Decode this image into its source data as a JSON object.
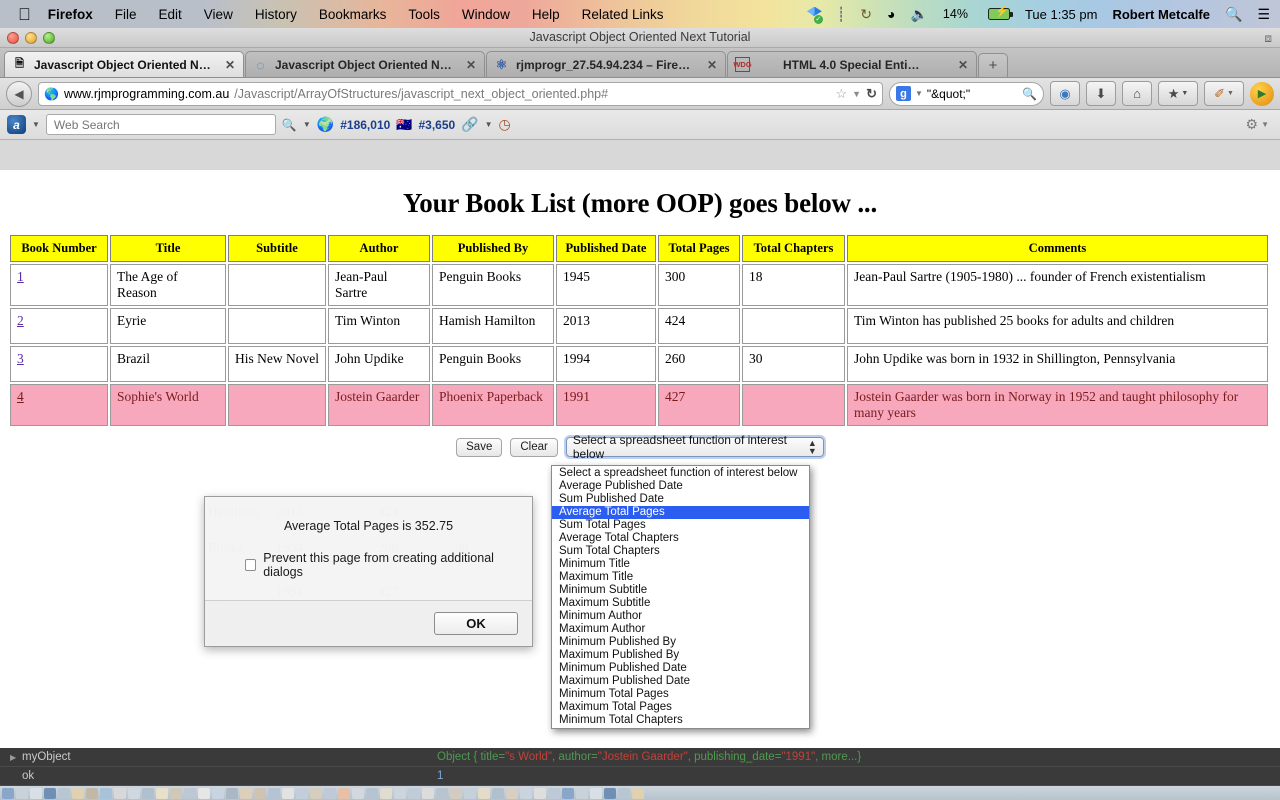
{
  "menubar": {
    "apple_icon": "apple-icon",
    "items": [
      "Firefox",
      "File",
      "Edit",
      "View",
      "History",
      "Bookmarks",
      "Tools",
      "Window",
      "Help",
      "Related Links"
    ],
    "status": {
      "dropbox_icon": "dropbox-icon",
      "bluetooth_icon": "bluetooth-icon",
      "timemachine_icon": "time-machine-icon",
      "wifi_icon": "wifi-icon",
      "volume_icon": "volume-icon",
      "battery_percent": "14%",
      "battery_icon": "battery-charging-icon",
      "clock": "Tue 1:35 pm",
      "user": "Robert Metcalfe",
      "spotlight_icon": "search-icon",
      "notifications_icon": "notification-center-icon"
    }
  },
  "window": {
    "title": "Javascript Object Oriented Next Tutorial",
    "fullscreen_icon": "fullscreen-icon"
  },
  "tabs": [
    {
      "label": "Javascript Object Oriented Next…",
      "favicon": "page-icon",
      "active": true
    },
    {
      "label": "Javascript Object Oriented Next…",
      "favicon": "loading-icon",
      "active": false
    },
    {
      "label": "rjmprogr_27.54.94.234 – FireFTP",
      "favicon": "fireftp-icon",
      "active": false
    },
    {
      "label": "HTML 4.0 Special Entities",
      "favicon": "wdg-icon",
      "active": false
    }
  ],
  "newtab_label": "+",
  "navbar": {
    "back_icon": "back-arrow-icon",
    "site_icon": "globe-icon",
    "url_domain": "www.rjmprogramming.com.au",
    "url_path": "/Javascript/ArrayOfStructures/javascript_next_object_oriented.php#",
    "bookmark_star_icon": "star-icon",
    "dropdown_icon": "chevron-down-icon",
    "reload_icon": "reload-icon",
    "search_engine_icon": "google-icon",
    "search_value": "\"&quot;\"",
    "search_go_icon": "search-icon",
    "buttons": [
      {
        "name": "feedly-icon",
        "glyph": "◔"
      },
      {
        "name": "download-icon",
        "glyph": "⬇"
      },
      {
        "name": "home-icon",
        "glyph": "⌂"
      },
      {
        "name": "bookmarks-icon",
        "glyph": "★"
      },
      {
        "name": "addon-icon",
        "glyph": "✎"
      },
      {
        "name": "play-icon",
        "glyph": "▶"
      }
    ]
  },
  "alexabar": {
    "alexa_icon": "alexa-icon",
    "search_placeholder": "Web Search",
    "search_value": "",
    "search_go_icon": "search-icon",
    "global_rank_icon": "globe-icon",
    "global_rank": "#186,010",
    "country_rank_icon": "au-flag-icon",
    "country_rank": "#3,650",
    "link_icon": "link-icon",
    "traffic_icon": "traffic-icon",
    "gear_icon": "gear-icon"
  },
  "page": {
    "title": "Your Book List (more OOP) goes below ...",
    "table": {
      "headers": [
        "Book Number",
        "Title",
        "Subtitle",
        "Author",
        "Published By",
        "Published Date",
        "Total Pages",
        "Total Chapters",
        "Comments"
      ],
      "rows": [
        {
          "highlighted": false,
          "cells": [
            "1",
            "The Age of Reason",
            "",
            "Jean-Paul Sartre",
            "Penguin Books",
            "1945",
            "300",
            "18",
            "Jean-Paul Sartre (1905-1980) ... founder of French existentialism"
          ]
        },
        {
          "highlighted": false,
          "cells": [
            "2",
            "Eyrie",
            "",
            "Tim Winton",
            "Hamish Hamilton",
            "2013",
            "424",
            "",
            "Tim Winton has published 25 books for adults and children"
          ]
        },
        {
          "highlighted": false,
          "cells": [
            "3",
            "Brazil",
            "His New Novel",
            "John Updike",
            "Penguin Books",
            "1994",
            "260",
            "30",
            "John Updike was born in 1932 in Shillington, Pennsylvania"
          ]
        },
        {
          "highlighted": true,
          "cells": [
            "4",
            "Sophie's World",
            "",
            "Jostein Gaarder",
            "Phoenix Paperback",
            "1991",
            "427",
            "",
            "Jostein Gaarder was born in Norway in 1952 and taught philosophy for many years"
          ]
        }
      ]
    },
    "controls": {
      "save_label": "Save",
      "clear_label": "Clear",
      "select_value": "Select a spreadsheet function of interest below",
      "select_arrows_icon": "updown-arrows-icon"
    },
    "dropdown": {
      "selected_index": 3,
      "options": [
        "Select a spreadsheet function of interest below",
        "Average Published Date",
        "Sum Published Date",
        "Average Total Pages",
        "Sum Total Pages",
        "Average Total Chapters",
        "Sum Total Chapters",
        "Minimum Title",
        "Maximum Title",
        "Minimum Subtitle",
        "Maximum Subtitle",
        "Minimum Author",
        "Maximum Author",
        "Minimum Published By",
        "Maximum Published By",
        "Minimum Published Date",
        "Maximum Published Date",
        "Minimum Total Pages",
        "Maximum Total Pages",
        "Minimum Total Chapters"
      ]
    }
  },
  "dialog": {
    "message": "Average Total Pages is 352.75",
    "checkbox_label": "Prevent this page from creating additional dialogs",
    "checkbox_checked": false,
    "ok_label": "OK"
  },
  "console": {
    "rows": [
      {
        "twisty": "▶",
        "name": "myObject",
        "type": "object",
        "obj_prefix": "Object { title=",
        "v1": "\"s World\"",
        "m1": ", author=",
        "v2": "\"Jostein Gaarder\"",
        "m2": ", publishing_date=",
        "v3": "\"1991\"",
        "suffix": ", more...}"
      },
      {
        "twisty": "",
        "name": "ok",
        "type": "value",
        "value": "1"
      }
    ]
  },
  "colors": {
    "table_header_bg": "#ffff00",
    "highlight_row_bg": "#f7a8bd",
    "highlight_row_text": "#7a1b1b",
    "dropdown_selected_bg": "#2b5df0",
    "link": "#5a2da8"
  }
}
